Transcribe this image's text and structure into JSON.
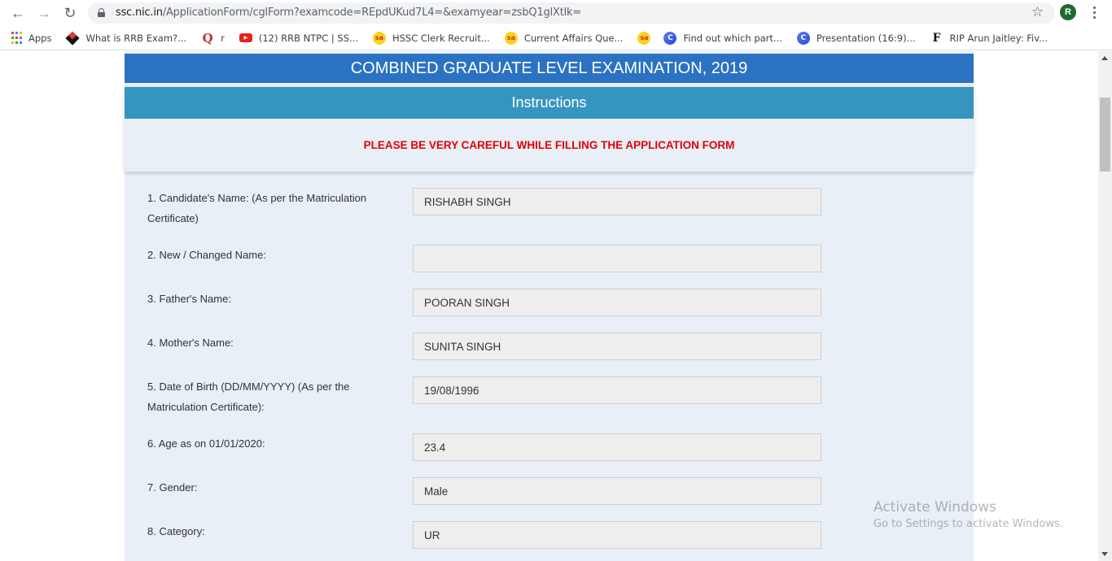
{
  "browser": {
    "url_host": "ssc.nic.in",
    "url_path": "/ApplicationForm/cglForm?examcode=REpdUKud7L4=&examyear=zsbQ1glXtlk=",
    "profile_initial": "R",
    "bookmarks": [
      {
        "label": "Apps",
        "icon": "apps-grid-icon"
      },
      {
        "label": "What is RRB Exam?...",
        "icon": "diamond-logo-icon"
      },
      {
        "label": "r",
        "icon": "quora-icon"
      },
      {
        "label": "(12) RRB NTPC | SS...",
        "icon": "youtube-icon"
      },
      {
        "label": "HSSC Clerk Recruit...",
        "icon": "sa-logo-icon"
      },
      {
        "label": "Current Affairs Que...",
        "icon": "sa-logo-icon"
      },
      {
        "label": "",
        "icon": "sa-logo-icon"
      },
      {
        "label": "Find out which part...",
        "icon": "canva-icon"
      },
      {
        "label": "Presentation (16:9)...",
        "icon": "canva-icon"
      },
      {
        "label": "RIP Arun Jaitley: Fiv...",
        "icon": "forbes-icon"
      }
    ]
  },
  "page": {
    "exam_title": "COMBINED GRADUATE LEVEL EXAMINATION, 2019",
    "instructions_title": "Instructions",
    "warning": "PLEASE BE VERY CAREFUL WHILE FILLING THE APPLICATION FORM",
    "fields": [
      {
        "label": "1. Candidate's Name: (As per the Matriculation Certificate)",
        "value": "RISHABH SINGH"
      },
      {
        "label": "2. New / Changed Name:",
        "value": ""
      },
      {
        "label": "3. Father's Name:",
        "value": "POORAN SINGH"
      },
      {
        "label": "4. Mother's Name:",
        "value": "SUNITA SINGH"
      },
      {
        "label": "5. Date of Birth (DD/MM/YYYY) (As per the Matriculation Certificate):",
        "value": "19/08/1996"
      },
      {
        "label": "6. Age as on 01/01/2020:",
        "value": "23.4"
      },
      {
        "label": "7. Gender:",
        "value": "Male"
      },
      {
        "label": "8. Category:",
        "value": "UR"
      }
    ]
  },
  "watermark": {
    "title": "Activate Windows",
    "subtitle": "Go to Settings to activate Windows."
  }
}
